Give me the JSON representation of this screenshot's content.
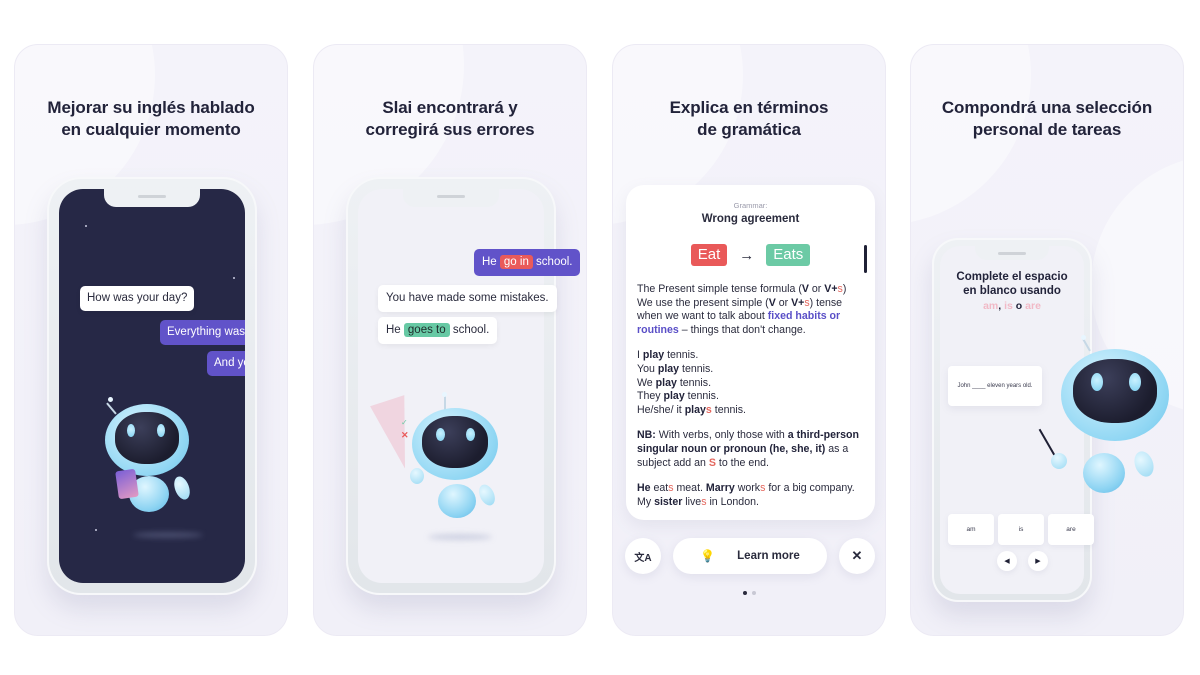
{
  "panels": [
    {
      "title": "Mejorar su inglés hablado\nen cualquier momento",
      "chat": [
        {
          "from": "bot",
          "text": "How was your day?"
        },
        {
          "from": "user",
          "text": "Everything was cool!"
        },
        {
          "from": "user",
          "text": "And yours?"
        }
      ],
      "screen_color": "#262846"
    },
    {
      "title": "Slai encontrará y\ncorregirá sus errores",
      "user_message": {
        "before": "He",
        "error": "go in",
        "after": "school."
      },
      "bot_reply": "You have made some mistakes.",
      "correction": {
        "before": "He",
        "fix": "goes to",
        "after": "school."
      },
      "icons": {
        "check": "✓",
        "cross": "✕"
      }
    },
    {
      "title": "Explica en términos\nde gramática",
      "grammar_label": "Grammar:",
      "grammar_title": "Wrong agreement",
      "wrong_word": "Eat",
      "correct_word": "Eats",
      "arrow": "→",
      "formula": {
        "line1_a": "The Present simple tense formula (",
        "v": "V",
        "or": " or ",
        "vplus": "V+",
        "s": "s",
        "close": ")",
        "line2_a": "We use the present simple (",
        "line2_b": ") tense when we want to talk about ",
        "highlight": "fixed habits or routines",
        "line2_c": " – things that don't change."
      },
      "examples": [
        {
          "subject": "I",
          "verb": "play",
          "suffix": "",
          "rest": "tennis."
        },
        {
          "subject": "You",
          "verb": "play",
          "suffix": "",
          "rest": "tennis."
        },
        {
          "subject": "We",
          "verb": "play",
          "suffix": "",
          "rest": "tennis."
        },
        {
          "subject": "They",
          "verb": "play",
          "suffix": "",
          "rest": "tennis."
        },
        {
          "subject": "He/she/ it",
          "verb": "play",
          "suffix": "s",
          "rest": "tennis."
        }
      ],
      "nb": {
        "label": "NB:",
        "a": " With verbs, only those with ",
        "b": "a third-person singular noun or pronoun (he, she, it)",
        "c": " as a subject add an ",
        "s": "S",
        "d": " to the end."
      },
      "sentences": {
        "he": "He",
        "eat": " eat",
        "s1": "s",
        "meat": " meat. ",
        "marry": "Marry",
        "work": " work",
        "s2": "s",
        "for": " for a big company. My ",
        "sister": "sister",
        "live": " live",
        "s3": "s",
        "london": " in London."
      },
      "learn_more_label": "Learn more",
      "translate_icon": "文A",
      "bulb_icon": "💡",
      "close_icon": "✕",
      "pagination": {
        "current": 1,
        "total": 2
      }
    },
    {
      "title": "Compondrá una selección\npersonal de tareas",
      "task_title": "Complete el espacio\nen blanco usando",
      "task_words": {
        "w1": "am",
        "sep1": ", ",
        "w2": "is",
        "o": " o ",
        "w3": "are"
      },
      "sentence": "John ____ eleven years old.",
      "choices": [
        "am",
        "is",
        "are"
      ],
      "prev_icon": "◀",
      "next_icon": "▶"
    }
  ]
}
